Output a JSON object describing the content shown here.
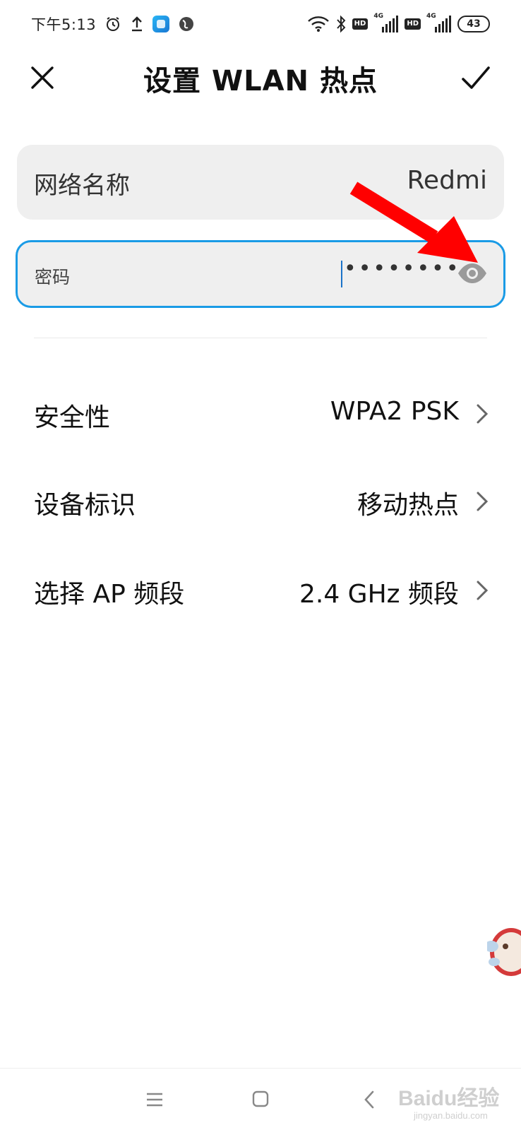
{
  "status_bar": {
    "time": "下午5:13",
    "left_icons": [
      "alarm-icon",
      "upload-icon",
      "app-badge-icon",
      "browser-icon"
    ],
    "right_icons": [
      "wifi-icon",
      "bluetooth-icon",
      "hd-badge",
      "signal-4g-icon",
      "hd-badge",
      "signal-4g-icon",
      "battery-icon"
    ],
    "hd_label": "HD",
    "net_label": "4G",
    "battery_level": "43"
  },
  "header": {
    "title": "设置 WLAN 热点",
    "close_icon": "close-icon",
    "confirm_icon": "check-icon"
  },
  "network_name": {
    "label": "网络名称",
    "value": "Redmi"
  },
  "password": {
    "label": "密码",
    "value": "••••••••",
    "toggle_icon": "eye-icon",
    "focused": true,
    "accent_color": "#1a9be6"
  },
  "settings": [
    {
      "label": "安全性",
      "value": "WPA2 PSK"
    },
    {
      "label": "设备标识",
      "value": "移动热点"
    },
    {
      "label": "选择 AP 频段",
      "value": "2.4 GHz 频段"
    }
  ],
  "annotation": {
    "arrow_color": "#ff0000"
  },
  "nav_bar": {
    "icons": [
      "menu-icon",
      "home-icon",
      "back-icon"
    ]
  },
  "watermark": {
    "brand": "Baidu经验",
    "url": "jingyan.baidu.com"
  }
}
